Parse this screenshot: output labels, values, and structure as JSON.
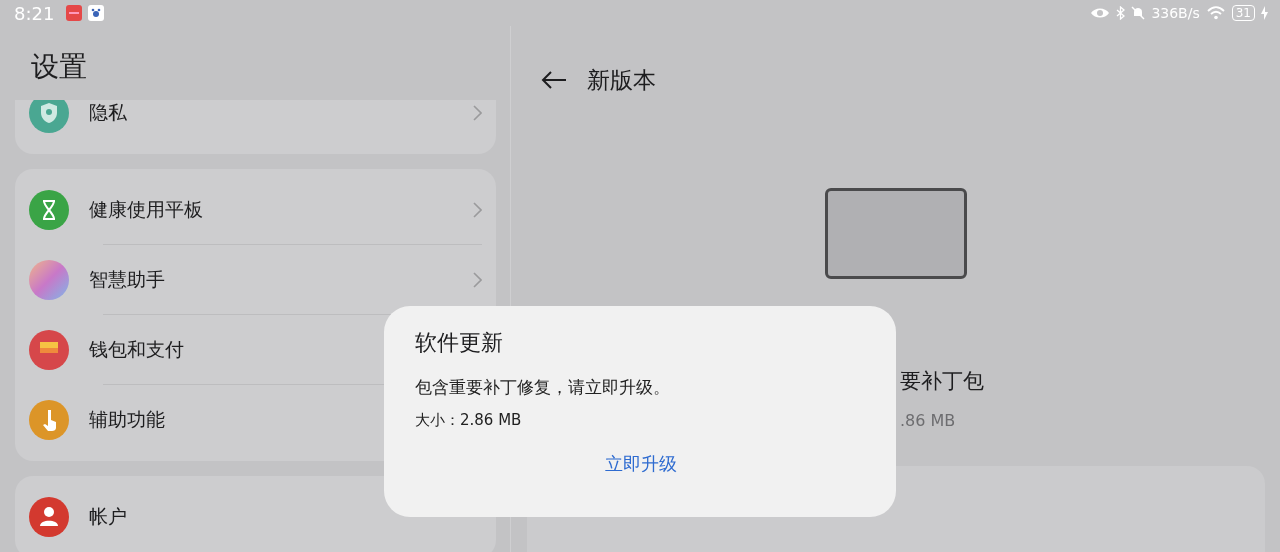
{
  "status_bar": {
    "time": "8:21",
    "net_speed": "336B/s",
    "battery": "31",
    "charging": true
  },
  "sidebar": {
    "title": "设置",
    "groups": [
      {
        "items": [
          {
            "label": "隐私",
            "kind": "privacy",
            "chevron": true
          }
        ]
      },
      {
        "items": [
          {
            "label": "健康使用平板",
            "kind": "hourglass",
            "chevron": true
          },
          {
            "label": "智慧助手",
            "kind": "assistant",
            "chevron": true
          },
          {
            "label": "钱包和支付",
            "kind": "wallet",
            "chevron": false
          },
          {
            "label": "辅助功能",
            "kind": "hand",
            "chevron": false
          }
        ]
      },
      {
        "items": [
          {
            "label": "帐户",
            "kind": "person",
            "chevron": false
          }
        ]
      }
    ]
  },
  "detail": {
    "title": "新版本",
    "package_name": "要补丁包",
    "package_size": ".86 MB"
  },
  "dialog": {
    "title": "软件更新",
    "message": "包含重要补丁修复，请立即升级。",
    "size": "大小：2.86 MB",
    "action": "立即升级"
  }
}
